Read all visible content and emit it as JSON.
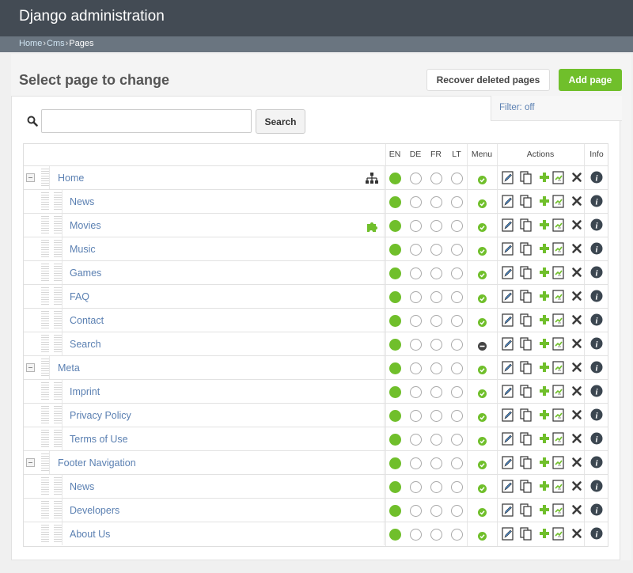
{
  "header": {
    "title": "Django administration"
  },
  "breadcrumbs": [
    "Home",
    "Cms",
    "Pages"
  ],
  "page": {
    "heading": "Select page to change"
  },
  "toolbar": {
    "recover_label": "Recover deleted pages",
    "add_label": "Add page"
  },
  "filter": {
    "label": "Filter: off"
  },
  "search": {
    "button": "Search",
    "value": ""
  },
  "columns": {
    "en": "EN",
    "de": "DE",
    "fr": "FR",
    "lt": "LT",
    "menu": "Menu",
    "actions": "Actions",
    "info": "Info"
  },
  "pages": [
    {
      "title": "Home",
      "level": 0,
      "expandable": true,
      "languages": [
        true,
        false,
        false,
        false
      ],
      "in_menu": true,
      "badge": "sitemap-icon"
    },
    {
      "title": "News",
      "level": 1,
      "expandable": false,
      "languages": [
        true,
        false,
        false,
        false
      ],
      "in_menu": true
    },
    {
      "title": "Movies",
      "level": 1,
      "expandable": false,
      "languages": [
        true,
        false,
        false,
        false
      ],
      "in_menu": true,
      "badge": "puzzle-icon"
    },
    {
      "title": "Music",
      "level": 1,
      "expandable": false,
      "languages": [
        true,
        false,
        false,
        false
      ],
      "in_menu": true
    },
    {
      "title": "Games",
      "level": 1,
      "expandable": false,
      "languages": [
        true,
        false,
        false,
        false
      ],
      "in_menu": true
    },
    {
      "title": "FAQ",
      "level": 1,
      "expandable": false,
      "languages": [
        true,
        false,
        false,
        false
      ],
      "in_menu": true
    },
    {
      "title": "Contact",
      "level": 1,
      "expandable": false,
      "languages": [
        true,
        false,
        false,
        false
      ],
      "in_menu": true
    },
    {
      "title": "Search",
      "level": 1,
      "expandable": false,
      "languages": [
        true,
        false,
        false,
        false
      ],
      "in_menu": false
    },
    {
      "title": "Meta",
      "level": 0,
      "expandable": true,
      "languages": [
        true,
        false,
        false,
        false
      ],
      "in_menu": true
    },
    {
      "title": "Imprint",
      "level": 1,
      "expandable": false,
      "languages": [
        true,
        false,
        false,
        false
      ],
      "in_menu": true
    },
    {
      "title": "Privacy Policy",
      "level": 1,
      "expandable": false,
      "languages": [
        true,
        false,
        false,
        false
      ],
      "in_menu": true
    },
    {
      "title": "Terms of Use",
      "level": 1,
      "expandable": false,
      "languages": [
        true,
        false,
        false,
        false
      ],
      "in_menu": true
    },
    {
      "title": "Footer Navigation",
      "level": 0,
      "expandable": true,
      "languages": [
        true,
        false,
        false,
        false
      ],
      "in_menu": true
    },
    {
      "title": "News",
      "level": 1,
      "expandable": false,
      "languages": [
        true,
        false,
        false,
        false
      ],
      "in_menu": true
    },
    {
      "title": "Developers",
      "level": 1,
      "expandable": false,
      "languages": [
        true,
        false,
        false,
        false
      ],
      "in_menu": true
    },
    {
      "title": "About Us",
      "level": 1,
      "expandable": false,
      "languages": [
        true,
        false,
        false,
        false
      ],
      "in_menu": true
    }
  ],
  "colors": {
    "header": "#434b54",
    "breadcrumb_bar": "#6a7580",
    "link": "#5b80b2",
    "accent_green": "#70bf2b",
    "dark_icon": "#3b4650"
  },
  "icons": {
    "search": "magnifier-icon",
    "menu_on": "check-circle-icon",
    "menu_off": "minus-circle-icon",
    "edit": "edit-icon",
    "copy": "copy-icon",
    "add": "plus-icon",
    "move": "move-page-icon",
    "delete": "delete-icon",
    "info": "info-icon"
  }
}
